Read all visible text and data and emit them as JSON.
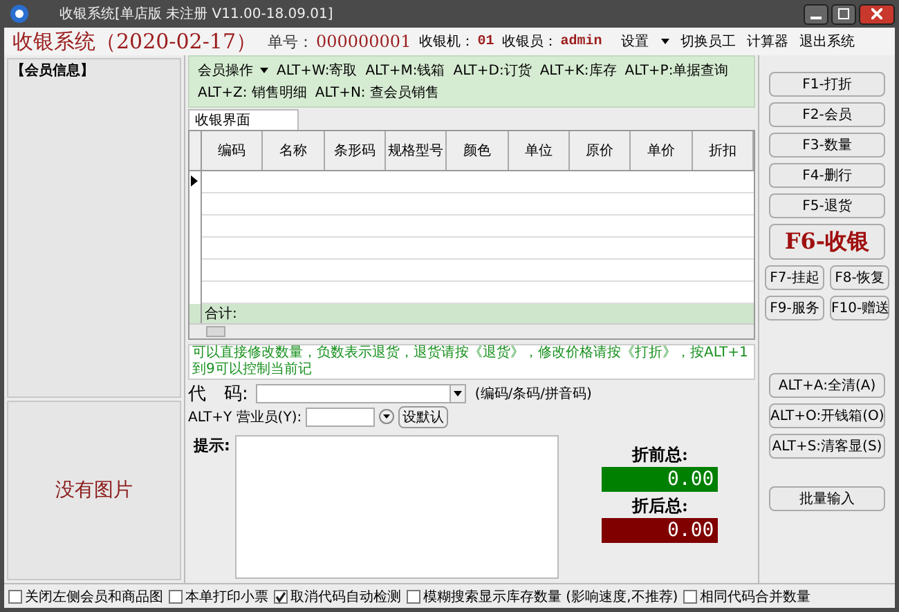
{
  "window": {
    "title": "收银系统[单店版 未注册 V11.00-18.09.01]"
  },
  "header": {
    "app_title": "收银系统（2020-02-17）",
    "order_label": "单号：",
    "order_no": "000000001",
    "register_label": "收银机：",
    "register": "01",
    "cashier_label": "收银员：",
    "cashier": "admin",
    "menu": [
      {
        "label": "设置",
        "dropdown": true
      },
      {
        "label": "切换员工",
        "dropdown": false
      },
      {
        "label": "计算器",
        "dropdown": false
      },
      {
        "label": "退出系统",
        "dropdown": false
      }
    ]
  },
  "member_panel": {
    "title": "【会员信息】",
    "image_text": "没有图片"
  },
  "toolbar": [
    {
      "label": "会员操作",
      "dropdown": true
    },
    {
      "label": "ALT+W:寄取",
      "dropdown": false
    },
    {
      "label": "ALT+M:钱箱",
      "dropdown": false
    },
    {
      "label": "ALT+D:订货",
      "dropdown": false
    },
    {
      "label": "ALT+K:库存",
      "dropdown": false
    },
    {
      "label": "ALT+P:单据查询",
      "dropdown": false
    },
    {
      "label": "ALT+Z: 销售明细",
      "dropdown": false
    },
    {
      "label": "ALT+N: 查会员销售",
      "dropdown": false
    }
  ],
  "tabs": [
    {
      "label": "收银界面",
      "selected": true
    }
  ],
  "table": {
    "columns": [
      "编码",
      "名称",
      "条形码",
      "规格型号",
      "颜色",
      "单位",
      "原价",
      "单价",
      "折扣"
    ],
    "total_label": "合计:"
  },
  "hint": "可以直接修改数量，负数表示退货，退货请按《退货》，修改价格请按《打折》，按ALT+1到9可以控制当前记",
  "code": {
    "label": "代　码:",
    "note": "(编码/条码/拼音码)"
  },
  "salesperson": {
    "label": "ALT+Y 营业员(Y):",
    "button": "设默认"
  },
  "prompt_label": "提示:",
  "totals": [
    {
      "label": "折前总:",
      "value": "0.00",
      "color": "#008000"
    },
    {
      "label": "折后总:",
      "value": "0.00",
      "color": "#800000"
    }
  ],
  "function_buttons": [
    {
      "label": "F1-打折",
      "kind": "wide"
    },
    {
      "label": "F2-会员",
      "kind": "wide"
    },
    {
      "label": "F3-数量",
      "kind": "wide"
    },
    {
      "label": "F4-删行",
      "kind": "wide"
    },
    {
      "label": "F5-退货",
      "kind": "wide"
    },
    {
      "label": "F6-收银",
      "kind": "big"
    },
    {
      "label": "F7-挂起",
      "kind": "half"
    },
    {
      "label": "F8-恢复",
      "kind": "half"
    },
    {
      "label": "F9-服务",
      "kind": "half"
    },
    {
      "label": "F10-赠送",
      "kind": "half"
    }
  ],
  "extra_buttons": [
    "ALT+A:全清(A)",
    "ALT+O:开钱箱(O)",
    "ALT+S:清客显(S)"
  ],
  "batch_button": "批量输入",
  "options": [
    {
      "label": "关闭左侧会员和商品图",
      "checked": false
    },
    {
      "label": "本单打印小票",
      "checked": false
    },
    {
      "label": "取消代码自动检测",
      "checked": true
    },
    {
      "label": "模糊搜索显示库存数量 (影响速度,不推荐)",
      "checked": false
    },
    {
      "label": "相同代码合并数量",
      "checked": false
    }
  ]
}
